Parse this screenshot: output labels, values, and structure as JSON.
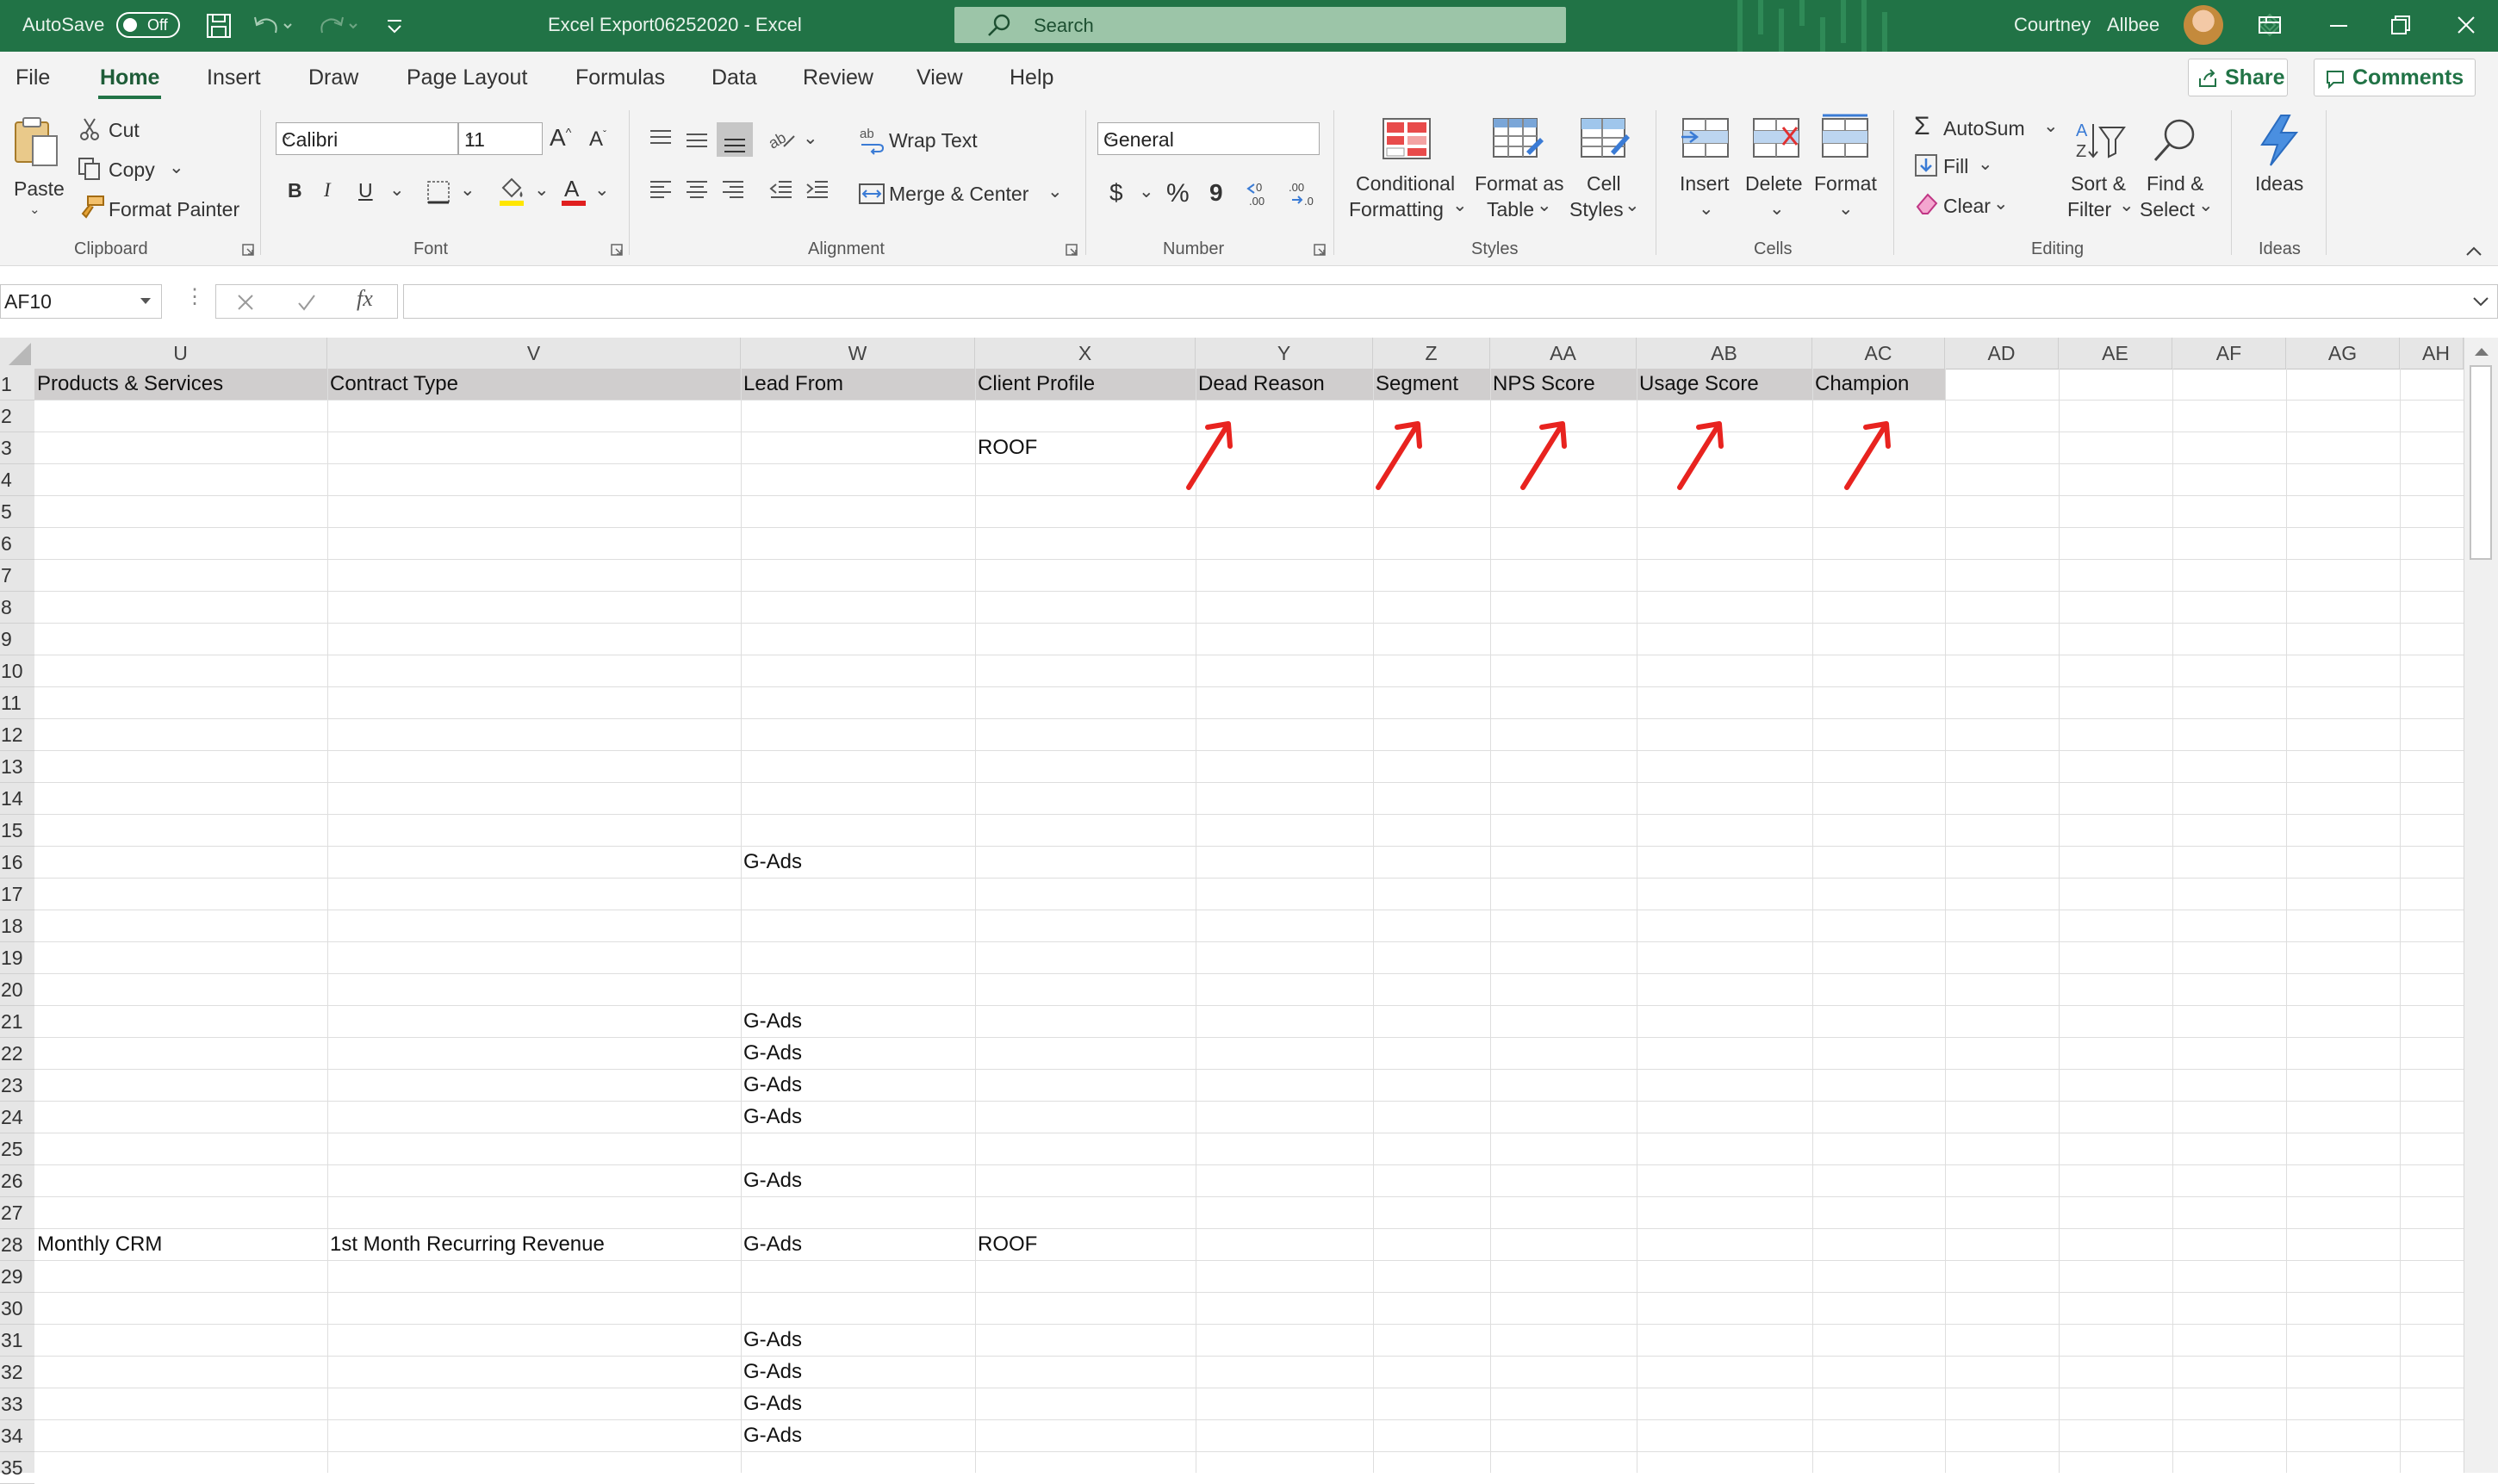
{
  "titlebar": {
    "autosave_label": "AutoSave",
    "autosave_state": "Off",
    "doc_title": "Excel Export06252020  -  Excel",
    "search_placeholder": "Search",
    "user_first": "Courtney",
    "user_last": "Allbee"
  },
  "tabs": [
    "File",
    "Home",
    "Insert",
    "Draw",
    "Page Layout",
    "Formulas",
    "Data",
    "Review",
    "View",
    "Help"
  ],
  "active_tab": "Home",
  "share_label": "Share",
  "comments_label": "Comments",
  "ribbon": {
    "clipboard": {
      "paste": "Paste",
      "cut": "Cut",
      "copy": "Copy",
      "format_painter": "Format Painter",
      "group": "Clipboard"
    },
    "font": {
      "name": "Calibri",
      "size": "11",
      "bold": "B",
      "italic": "I",
      "underline": "U",
      "group": "Font"
    },
    "alignment": {
      "wrap": "Wrap Text",
      "merge": "Merge & Center",
      "group": "Alignment"
    },
    "number": {
      "format": "General",
      "currency": "$",
      "percent": "%",
      "comma": "9",
      "group": "Number"
    },
    "styles": {
      "conditional_1": "Conditional",
      "conditional_2": "Formatting",
      "format_table_1": "Format as",
      "format_table_2": "Table",
      "cell_styles_1": "Cell",
      "cell_styles_2": "Styles",
      "group": "Styles"
    },
    "cells": {
      "insert": "Insert",
      "delete": "Delete",
      "format": "Format",
      "group": "Cells"
    },
    "editing": {
      "autosum": "AutoSum",
      "fill": "Fill",
      "clear": "Clear",
      "sort_1": "Sort &",
      "sort_2": "Filter",
      "find_1": "Find &",
      "find_2": "Select",
      "group": "Editing"
    },
    "ideas": {
      "label": "Ideas",
      "group": "Ideas"
    }
  },
  "formula_bar": {
    "name_box": "AF10",
    "fx": "fx",
    "value": ""
  },
  "columns": [
    "U",
    "V",
    "W",
    "X",
    "Y",
    "Z",
    "AA",
    "AB",
    "AC",
    "AD",
    "AE",
    "AF",
    "AG",
    "AH"
  ],
  "rows": [
    "1",
    "2",
    "3",
    "4",
    "5",
    "6",
    "7",
    "8",
    "9",
    "10",
    "11",
    "12",
    "13",
    "14",
    "15",
    "16",
    "17",
    "18",
    "19",
    "20",
    "21",
    "22",
    "23",
    "24",
    "25",
    "26",
    "27",
    "28",
    "29",
    "30",
    "31",
    "32",
    "33",
    "34",
    "35"
  ],
  "header_row": [
    "Products & Services",
    "Contract Type",
    "Lead From",
    "Client Profile",
    "Dead Reason",
    "Segment",
    "NPS Score",
    "Usage Score",
    "Champion"
  ],
  "cells": [
    {
      "row": 3,
      "col": "X",
      "value": "ROOF"
    },
    {
      "row": 16,
      "col": "W",
      "value": "G-Ads"
    },
    {
      "row": 21,
      "col": "W",
      "value": "G-Ads"
    },
    {
      "row": 22,
      "col": "W",
      "value": "G-Ads"
    },
    {
      "row": 23,
      "col": "W",
      "value": "G-Ads"
    },
    {
      "row": 24,
      "col": "W",
      "value": "G-Ads"
    },
    {
      "row": 26,
      "col": "W",
      "value": "G-Ads"
    },
    {
      "row": 28,
      "col": "U",
      "value": "Monthly CRM"
    },
    {
      "row": 28,
      "col": "V",
      "value": "1st Month Recurring Revenue"
    },
    {
      "row": 28,
      "col": "W",
      "value": "G-Ads"
    },
    {
      "row": 28,
      "col": "X",
      "value": "ROOF"
    },
    {
      "row": 31,
      "col": "W",
      "value": "G-Ads"
    },
    {
      "row": 32,
      "col": "W",
      "value": "G-Ads"
    },
    {
      "row": 33,
      "col": "W",
      "value": "G-Ads"
    },
    {
      "row": 34,
      "col": "W",
      "value": "G-Ads"
    }
  ],
  "annotation_color": "#e8231f",
  "accent_color": "#217346"
}
